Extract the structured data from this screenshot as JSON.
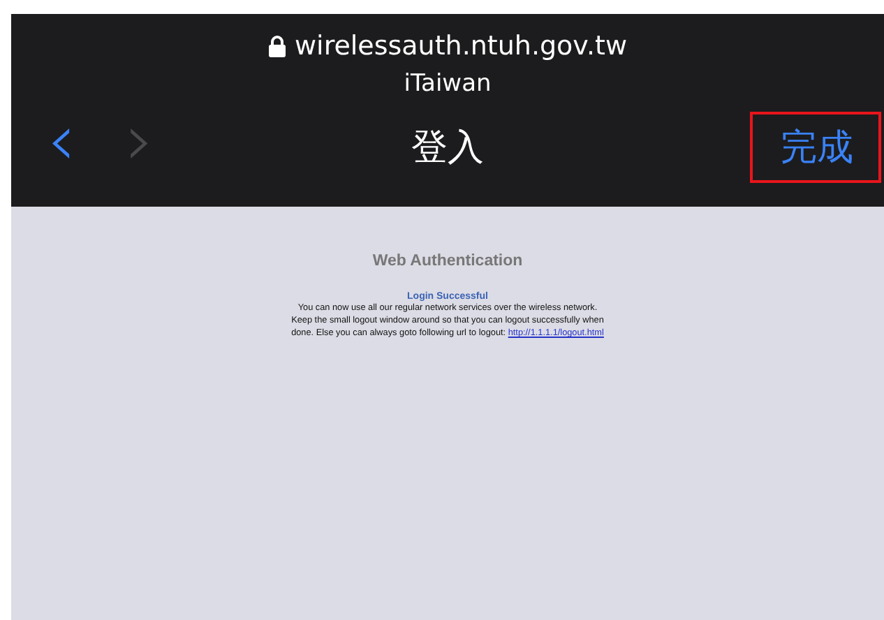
{
  "address_bar": {
    "secure": true,
    "url": "wirelessauth.ntuh.gov.tw",
    "subtitle": "iTaiwan"
  },
  "nav": {
    "back": {
      "glyph": "‹",
      "disabled": false
    },
    "forward": {
      "glyph": "›",
      "disabled": true
    },
    "title": "登入",
    "done": {
      "label": "完成",
      "highlighted": true
    }
  },
  "page": {
    "heading": "Web Authentication",
    "status": "Login Successful",
    "paragraphs": [
      {
        "text": "You can now use all our regular network services over the wireless network."
      },
      {
        "text": "Keep the small logout window around so that you can logout successfully when done. Else you can always goto following url to logout:",
        "link": "http://1.1.1.1/logout.html"
      }
    ]
  }
}
